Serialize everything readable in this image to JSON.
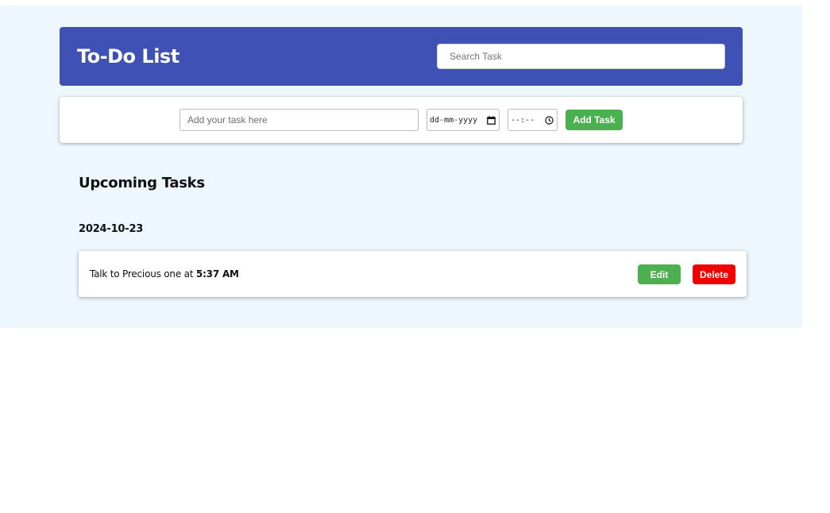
{
  "header": {
    "title": "To-Do List",
    "search_placeholder": "Search Task"
  },
  "add_task": {
    "task_placeholder": "Add your task here",
    "date_placeholder": "dd-mm-yyyy",
    "date_icon": "calendar-icon",
    "time_placeholder": "--:--",
    "time_icon": "clock-icon",
    "add_label": "Add Task"
  },
  "upcoming": {
    "title": "Upcoming Tasks",
    "groups": [
      {
        "date": "2024-10-23",
        "tasks": [
          {
            "text": "Talk to Precious one at",
            "time": "5:37 AM",
            "edit_label": "Edit",
            "delete_label": "Delete"
          }
        ]
      }
    ]
  },
  "colors": {
    "page_bg": "#eef6fe",
    "header_bg": "#3f51b5",
    "add_button": "#4caf50",
    "edit_button": "#4caf50",
    "delete_button": "#f20000"
  }
}
